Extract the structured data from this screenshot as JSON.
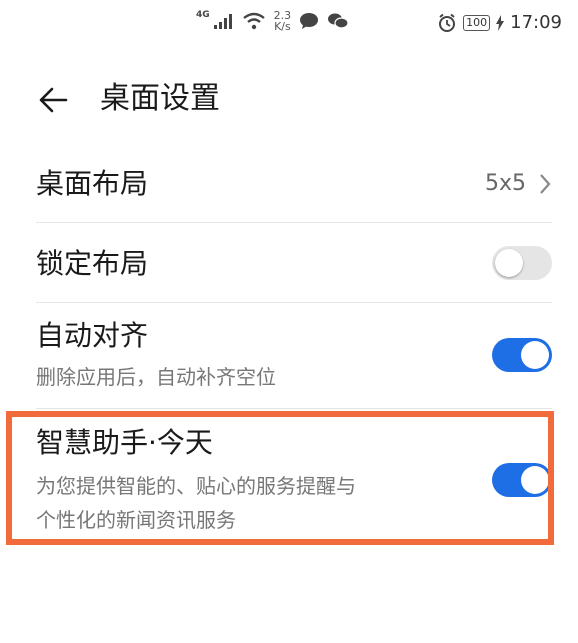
{
  "status_bar": {
    "network": "4G",
    "speed_value": "2.3",
    "speed_unit": "K/s",
    "battery": "100",
    "time": "17:09"
  },
  "header": {
    "title": "桌面设置"
  },
  "settings": [
    {
      "label": "桌面布局",
      "value": "5x5"
    },
    {
      "label": "锁定布局",
      "toggle_on": false
    },
    {
      "label": "自动对齐",
      "sublabel": "删除应用后，自动补齐空位",
      "toggle_on": true
    },
    {
      "label": "智慧助手·今天",
      "sublabel_line1": "为您提供智能的、贴心的服务提醒与",
      "sublabel_line2": "个性化的新闻资讯服务",
      "toggle_on": true
    }
  ],
  "colors": {
    "accent": "#1e6ee6",
    "highlight": "#f26b3a",
    "toggle_off": "#e5e5e5"
  }
}
